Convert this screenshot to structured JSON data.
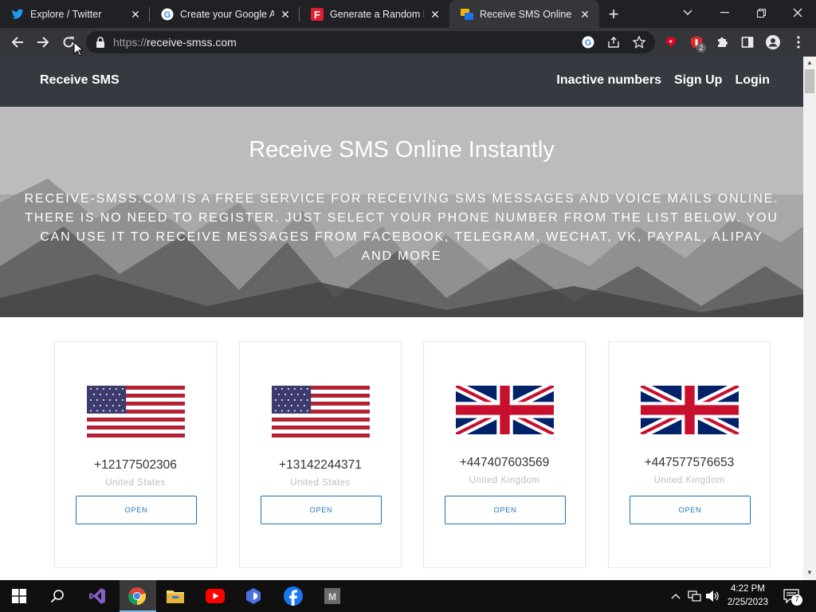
{
  "browser": {
    "tabs": [
      {
        "title": "Explore / Twitter",
        "icon": "twitter-icon"
      },
      {
        "title": "Create your Google Acco",
        "icon": "google-icon"
      },
      {
        "title": "Generate a Random Na",
        "icon": "fakename-icon"
      },
      {
        "title": "Receive SMS Online | Te",
        "icon": "receive-sms-icon",
        "active": true
      }
    ],
    "url_scheme": "https://",
    "url_host": "receive-smss.com",
    "extension_badge": "2"
  },
  "site": {
    "brand": "Receive SMS",
    "nav": [
      "Inactive numbers",
      "Sign Up",
      "Login"
    ],
    "hero_title": "Receive SMS Online Instantly",
    "hero_text": "RECEIVE-SMSS.COM IS A FREE SERVICE FOR RECEIVING SMS MESSAGES AND VOICE MAILS ONLINE. THERE IS NO NEED TO REGISTER. JUST SELECT YOUR PHONE NUMBER FROM THE LIST BELOW. YOU CAN USE IT TO RECEIVE MESSAGES FROM FACEBOOK, TELEGRAM, WECHAT, VK, PAYPAL, ALIPAY AND MORE",
    "cards": [
      {
        "number": "+12177502306",
        "country": "United States",
        "flag": "us-flag-icon",
        "button": "OPEN"
      },
      {
        "number": "+13142244371",
        "country": "United States",
        "flag": "us-flag-icon",
        "button": "OPEN"
      },
      {
        "number": "+447407603569",
        "country": "United Kingdom",
        "flag": "uk-flag-icon",
        "button": "OPEN"
      },
      {
        "number": "+447577576653",
        "country": "United Kingdom",
        "flag": "uk-flag-icon",
        "button": "OPEN"
      }
    ]
  },
  "taskbar": {
    "time": "4:22 PM",
    "date": "2/25/2023",
    "notification_count": "7",
    "apps": [
      "start-icon",
      "search-icon",
      "visual-studio-icon",
      "chrome-icon",
      "file-explorer-icon",
      "youtube-icon",
      "app-icon",
      "facebook-icon",
      "m-app-icon"
    ]
  },
  "colors": {
    "navbar": "#343a40",
    "accent": "#1a73b8",
    "chrome_dark": "#202124"
  }
}
